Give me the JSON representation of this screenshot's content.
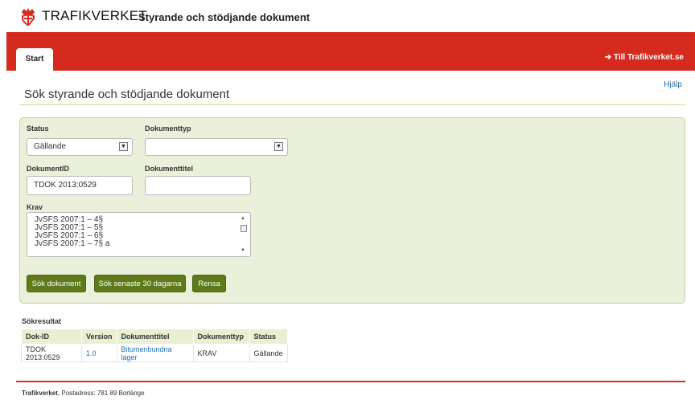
{
  "header": {
    "brand": "TRAFIKVERKET",
    "site_title": "Styrande och stödjande dokument"
  },
  "nav": {
    "tab_start": "Start",
    "to_trafikverket": "➔ Till Trafikverket.se"
  },
  "page": {
    "help_link": "Hjälp",
    "title": "Sök styrande och stödjande dokument"
  },
  "form": {
    "status_label": "Status",
    "status_value": "Gällande",
    "doctype_label": "Dokumenttyp",
    "doctype_value": "",
    "docid_label": "DokumentID",
    "docid_value": "TDOK 2013:0529",
    "doctitle_label": "Dokumenttitel",
    "doctitle_value": "",
    "krav_label": "Krav",
    "krav_options": [
      "JvSFS 2007:1 – 4§",
      "JvSFS 2007:1 – 5§",
      "JvSFS 2007:1 – 6§",
      "JvSFS 2007:1 – 7§ a"
    ],
    "btn_search": "Sök dokument",
    "btn_recent": "Sök senaste 30 dagarna",
    "btn_clear": "Rensa"
  },
  "results": {
    "title": "Sökresultat",
    "columns": [
      "Dok-ID",
      "Version",
      "Dokumenttitel",
      "Dokumenttyp",
      "Status"
    ],
    "rows": [
      [
        "TDOK 2013:0529",
        "1.0",
        "Bitumenbundna lager",
        "KRAV",
        "Gällande"
      ]
    ]
  },
  "footer": {
    "org": "Trafikverket",
    "address": ", Postadress: 781 89 Borlänge"
  },
  "colors": {
    "brand_red": "#d52b1e",
    "panel_bg": "#eaf0da",
    "button_green": "#5e7a1a",
    "link_blue": "#1f6fb5"
  }
}
